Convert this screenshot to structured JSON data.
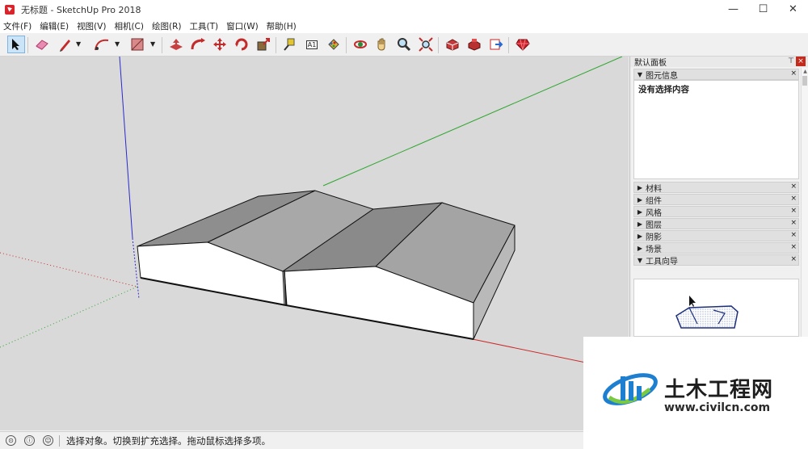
{
  "window": {
    "title": "无标题 - SketchUp Pro 2018",
    "minimize": "—",
    "maximize": "☐",
    "close": "✕"
  },
  "menu": [
    {
      "label": "文件(F)"
    },
    {
      "label": "编辑(E)"
    },
    {
      "label": "视图(V)"
    },
    {
      "label": "相机(C)"
    },
    {
      "label": "绘图(R)"
    },
    {
      "label": "工具(T)"
    },
    {
      "label": "窗口(W)"
    },
    {
      "label": "帮助(H)"
    }
  ],
  "toolbar": {
    "tools": [
      {
        "name": "select-tool",
        "icon": "cursor-arrow"
      },
      {
        "name": "eraser-tool",
        "icon": "eraser"
      },
      {
        "name": "line-tool",
        "icon": "pencil"
      },
      {
        "name": "arc-tool",
        "icon": "arc"
      },
      {
        "name": "shape-tool",
        "icon": "rectangle"
      },
      {
        "name": "push-pull-tool",
        "icon": "push-pull"
      },
      {
        "name": "follow-me-tool",
        "icon": "follow-me"
      },
      {
        "name": "move-tool",
        "icon": "move-arrows"
      },
      {
        "name": "rotate-tool",
        "icon": "rotate"
      },
      {
        "name": "scale-tool",
        "icon": "scale"
      },
      {
        "name": "tape-measure-tool",
        "icon": "tape-measure"
      },
      {
        "name": "text-tool",
        "icon": "text-a1"
      },
      {
        "name": "paint-bucket-tool",
        "icon": "paint-bucket"
      },
      {
        "name": "orbit-tool",
        "icon": "orbit"
      },
      {
        "name": "pan-tool",
        "icon": "hand"
      },
      {
        "name": "zoom-tool",
        "icon": "magnifier"
      },
      {
        "name": "zoom-extents-tool",
        "icon": "zoom-extents"
      },
      {
        "name": "warehouse-tool",
        "icon": "3d-warehouse"
      },
      {
        "name": "extension-warehouse-tool",
        "icon": "extension-warehouse"
      },
      {
        "name": "send-to-layout-tool",
        "icon": "send-to-layout"
      },
      {
        "name": "ruby-tool",
        "icon": "ruby"
      }
    ],
    "text_tool_glyph": "A1"
  },
  "panel": {
    "title": "默认面板",
    "pin": "⊤",
    "close": "×",
    "entity_info": {
      "title": "图元信息",
      "content": "没有选择内容"
    },
    "trays": [
      {
        "label": "材料"
      },
      {
        "label": "组件"
      },
      {
        "label": "风格"
      },
      {
        "label": "图层"
      },
      {
        "label": "阴影"
      },
      {
        "label": "场景"
      }
    ],
    "instructor": {
      "title": "工具向导"
    },
    "collapsed_arrow": "▶",
    "expanded_arrow": "▼",
    "tray_close": "×"
  },
  "status": {
    "text": "选择对象。切换到扩充选择。拖动鼠标选择多项。",
    "icons": [
      "geo-location-icon",
      "credits-icon",
      "user-icon"
    ],
    "glyphs": [
      "⊙",
      "ⓘ",
      "☺"
    ]
  },
  "watermark": {
    "cn": "土木工程网",
    "url": "www.civilcn.com"
  },
  "colors": {
    "axis_green": "#2ea52e",
    "axis_red": "#cc2a2a",
    "axis_blue": "#2a2acc",
    "background": "#d9d9d9",
    "face_front": "#ffffff",
    "roof_light": "#a9a9a9",
    "roof_dark": "#8a8a8a",
    "accent_logo": "#1e7fd1"
  }
}
